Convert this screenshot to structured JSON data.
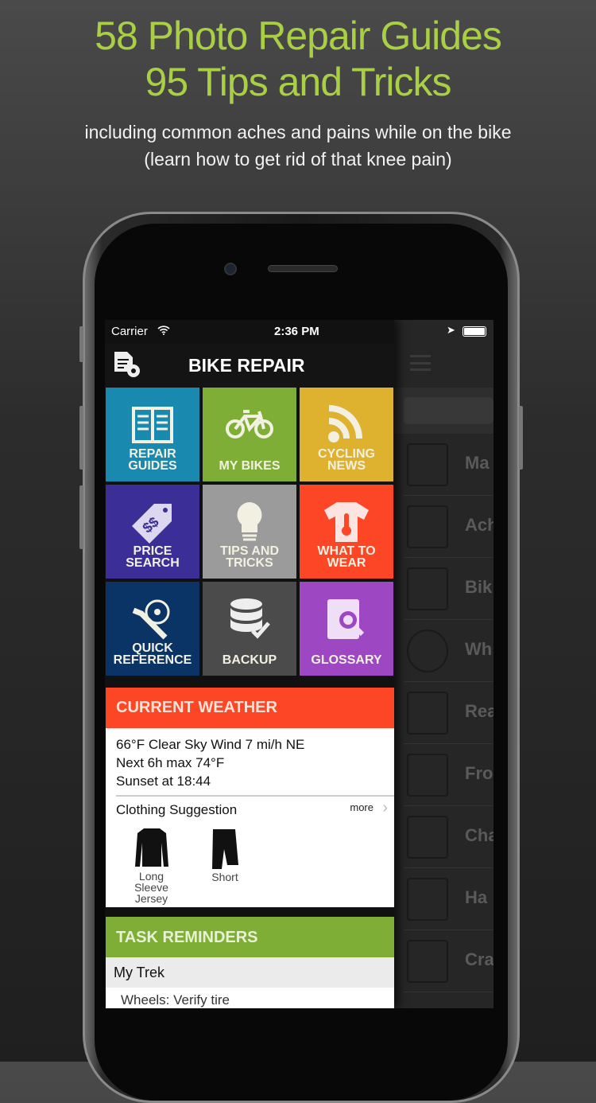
{
  "headline": {
    "line1": "58 Photo Repair Guides",
    "line2": "95 Tips and Tricks"
  },
  "subheadline": {
    "line1": "including common aches and pains while on the bike",
    "line2": "(learn how to get rid of that knee pain)"
  },
  "status_bar": {
    "carrier": "Carrier",
    "time": "2:36 PM"
  },
  "app": {
    "title": "BIKE REPAIR"
  },
  "tiles": [
    {
      "line1": "REPAIR",
      "line2": "GUIDES",
      "color": "#1a89b0",
      "icon": "book-icon"
    },
    {
      "line1": "MY BIKES",
      "line2": "",
      "color": "#7fae37",
      "icon": "bicycle-icon"
    },
    {
      "line1": "CYCLING",
      "line2": "NEWS",
      "color": "#deb12f",
      "icon": "rss-icon"
    },
    {
      "line1": "PRICE",
      "line2": "SEARCH",
      "color": "#3b2e96",
      "icon": "price-tag-icon"
    },
    {
      "line1": "TIPS AND",
      "line2": "TRICKS",
      "color": "#9b9b9b",
      "icon": "lightbulb-icon"
    },
    {
      "line1": "WHAT TO",
      "line2": "WEAR",
      "color": "#fd4626",
      "icon": "shirt-thermometer-icon"
    },
    {
      "line1": "QUICK",
      "line2": "REFERENCE",
      "color": "#0b3466",
      "icon": "wrench-stopwatch-icon"
    },
    {
      "line1": "BACKUP",
      "line2": "",
      "color": "#4b4b4b",
      "icon": "database-check-icon"
    },
    {
      "line1": "GLOSSARY",
      "line2": "",
      "color": "#9e47c2",
      "icon": "glossary-search-icon"
    }
  ],
  "weather": {
    "header": "CURRENT WEATHER",
    "line1": "66°F Clear Sky Wind 7 mi/h NE",
    "line2": "Next 6h max 74°F",
    "line3": "Sunset at 18:44",
    "clothing_label": "Clothing Suggestion",
    "more": "more",
    "items": [
      {
        "label1": "Long Sleeve",
        "label2": "Jersey"
      },
      {
        "label1": "Short",
        "label2": ""
      }
    ]
  },
  "tasks": {
    "header": "TASK REMINDERS",
    "bike": "My Trek",
    "item": "Wheels: Verify tire"
  },
  "side_menu": {
    "items": [
      "Ma",
      "Ach",
      "Bik",
      "Wh",
      "Rea",
      "Fro",
      "Cha",
      "Ha",
      "Cra"
    ]
  }
}
